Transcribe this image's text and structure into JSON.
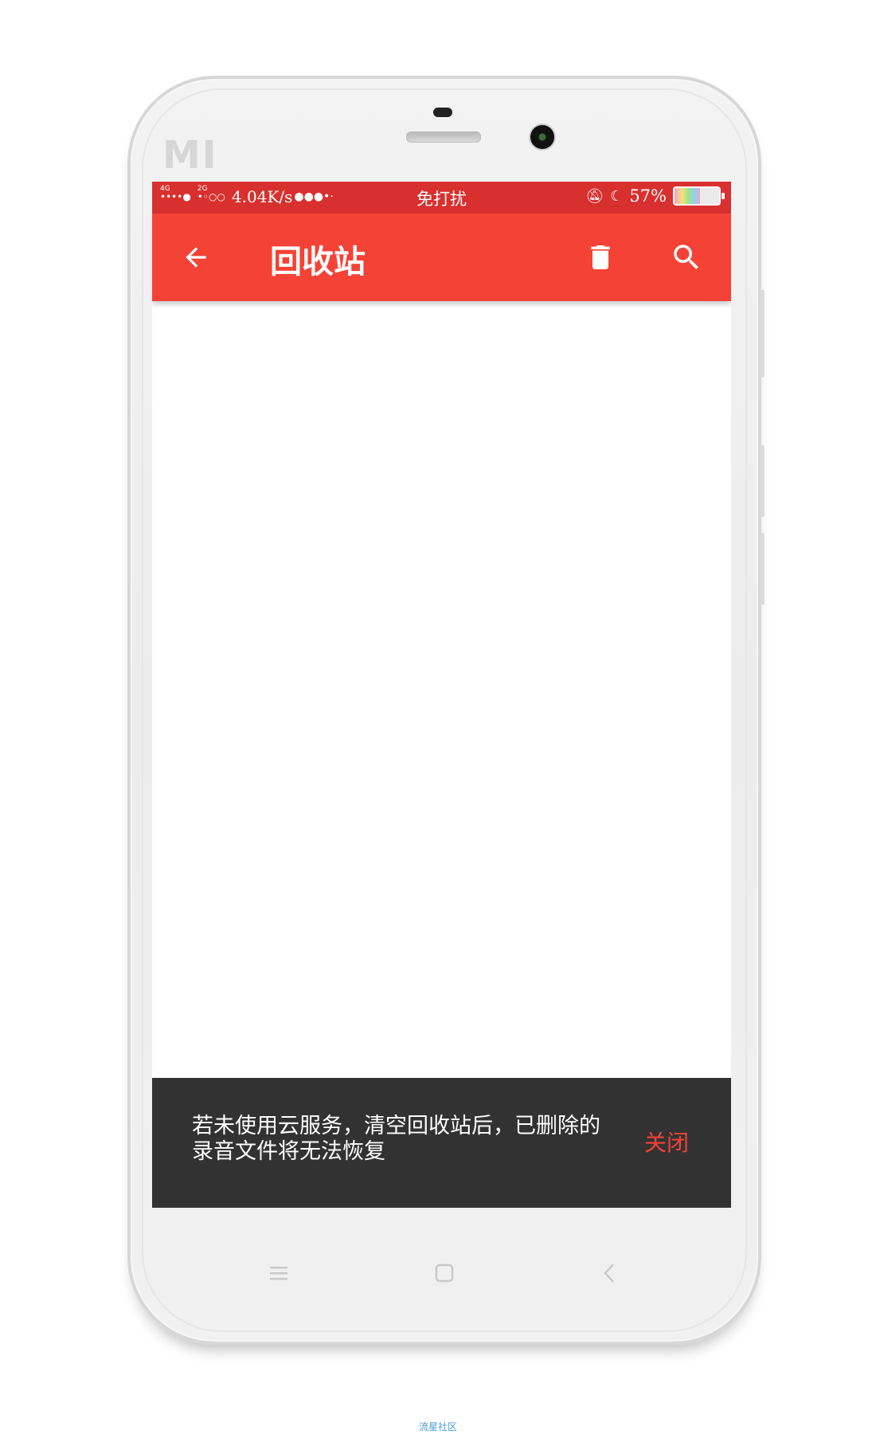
{
  "device": {
    "brand_logo": "MI"
  },
  "status_bar": {
    "network_primary": "4G",
    "network_secondary": "2G",
    "signal_primary": "••••●",
    "signal_secondary": "•◦○○",
    "speed": "4.04K/s",
    "mode_text": "免打扰",
    "battery_percent": "57%",
    "battery_level": 0.57
  },
  "app_bar": {
    "title": "回收站"
  },
  "snackbar": {
    "message": "若未使用云服务，清空回收站后，已删除的录音文件将无法恢复",
    "action_label": "关闭"
  },
  "footer": {
    "watermark": "流星社区"
  },
  "colors": {
    "primary": "#f44336",
    "status_bar": "#d8302e",
    "snackbar_bg": "#323232"
  }
}
